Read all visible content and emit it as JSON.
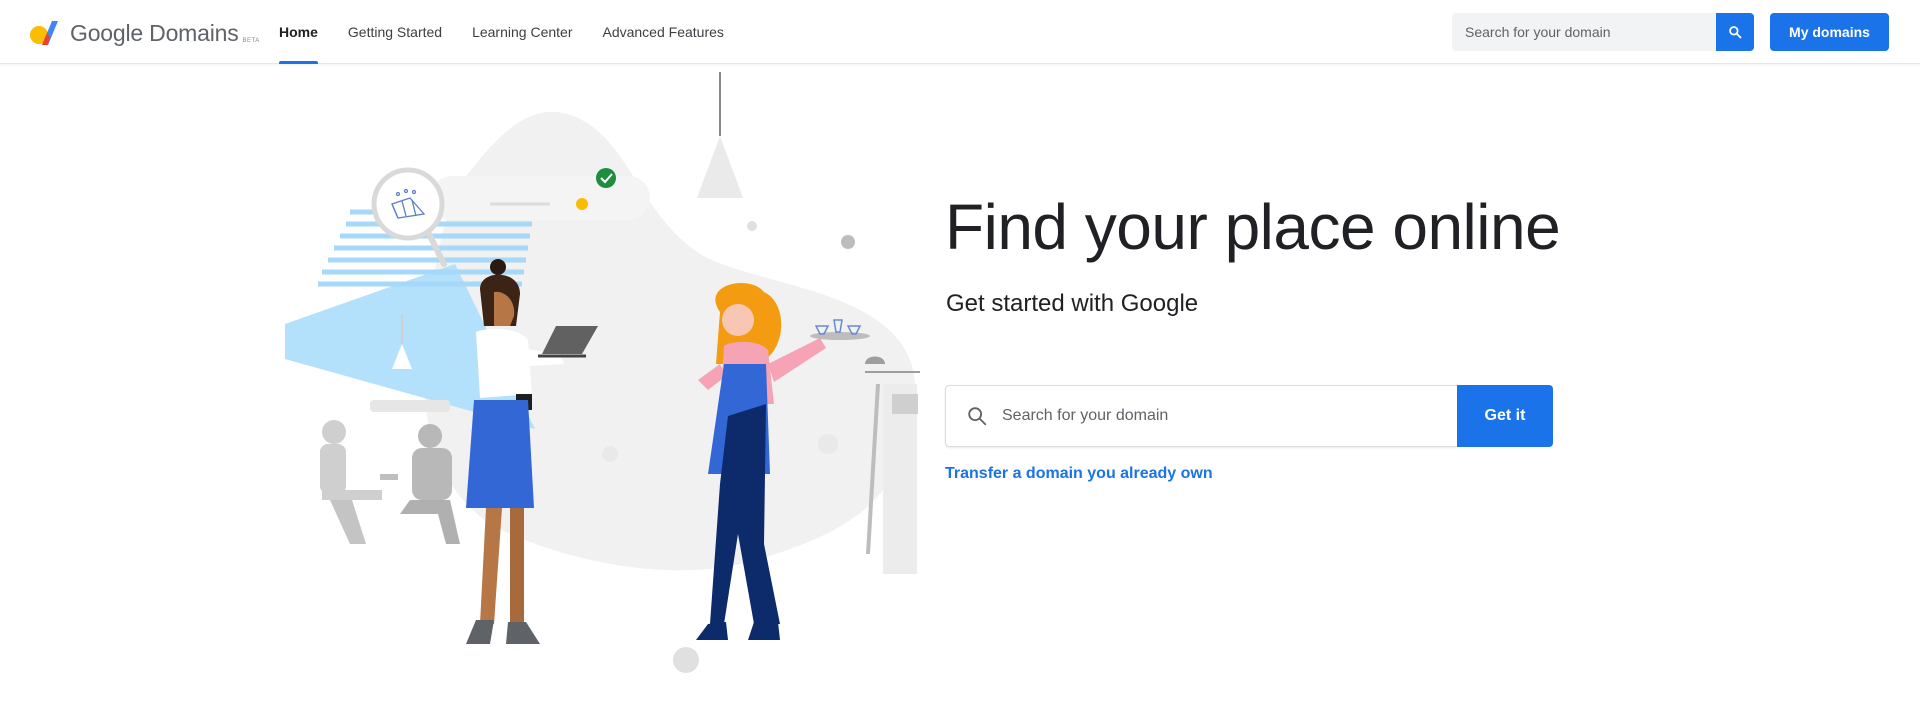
{
  "brand": {
    "name": "Google Domains",
    "badge": "BETA",
    "logo_icon": "google-domains-logo-icon"
  },
  "nav": {
    "items": [
      {
        "label": "Home",
        "active": true
      },
      {
        "label": "Getting Started",
        "active": false
      },
      {
        "label": "Learning Center",
        "active": false
      },
      {
        "label": "Advanced Features",
        "active": false
      }
    ]
  },
  "header": {
    "search_placeholder": "Search for your domain",
    "search_icon": "search-icon",
    "my_domains_label": "My domains"
  },
  "hero": {
    "title": "Find your place online",
    "subtitle": "Get started with Google",
    "search_placeholder": "Search for your domain",
    "search_icon": "search-icon",
    "cta_label": "Get it",
    "transfer_link": "Transfer a domain you already own"
  },
  "colors": {
    "accent": "#1a73e8",
    "text_primary": "#202124",
    "text_secondary": "#5f6368",
    "logo_yellow": "#fbbc04",
    "logo_red": "#ea4335",
    "logo_blue": "#4285f4"
  }
}
